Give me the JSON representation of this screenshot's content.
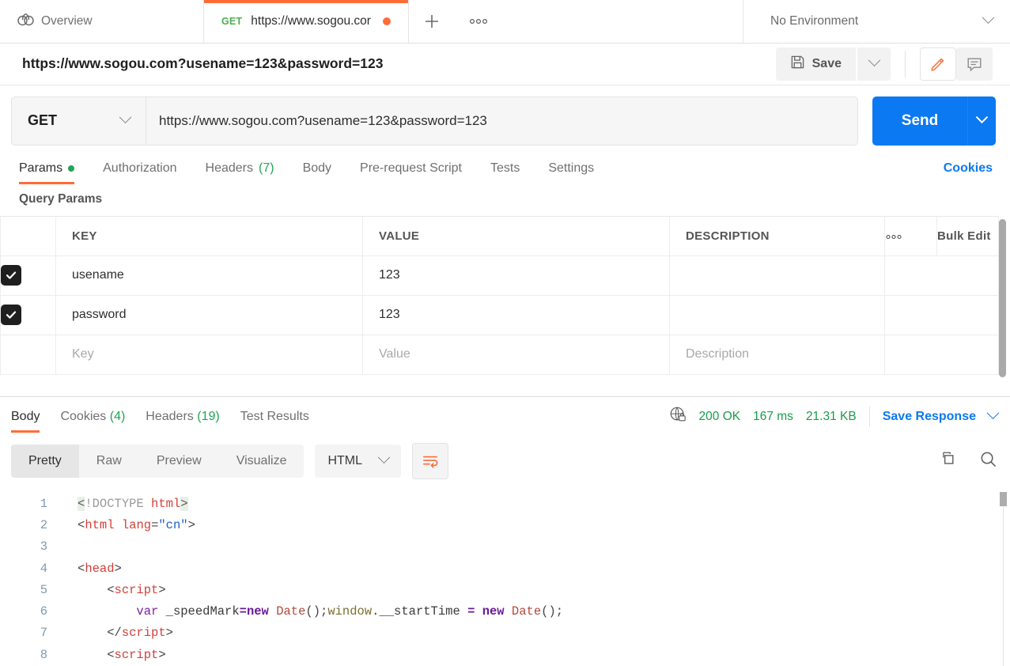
{
  "tabbar": {
    "overview_label": "Overview",
    "request_tab": {
      "method": "GET",
      "title": "https://www.sogou.cor"
    },
    "add_tab_label": "+",
    "more_label": "○○○",
    "environment": "No Environment"
  },
  "request_header": {
    "title": "https://www.sogou.com?usename=123&password=123",
    "save_label": "Save"
  },
  "url_row": {
    "method": "GET",
    "url": "https://www.sogou.com?usename=123&password=123",
    "send_label": "Send"
  },
  "request_tabs": [
    {
      "label": "Params",
      "dot": true
    },
    {
      "label": "Authorization"
    },
    {
      "label": "Headers",
      "count": "(7)"
    },
    {
      "label": "Body"
    },
    {
      "label": "Pre-request Script"
    },
    {
      "label": "Tests"
    },
    {
      "label": "Settings"
    }
  ],
  "cookies_link": "Cookies",
  "params": {
    "section_label": "Query Params",
    "columns": [
      "KEY",
      "VALUE",
      "DESCRIPTION"
    ],
    "more_label": "○○○",
    "bulk_edit_label": "Bulk Edit",
    "rows": [
      {
        "checked": true,
        "key": "usename",
        "value": "123",
        "description": ""
      },
      {
        "checked": true,
        "key": "password",
        "value": "123",
        "description": ""
      }
    ],
    "placeholder_row": {
      "key": "Key",
      "value": "Value",
      "description": "Description"
    }
  },
  "response": {
    "tabs": [
      {
        "label": "Body"
      },
      {
        "label": "Cookies",
        "count": "(4)"
      },
      {
        "label": "Headers",
        "count": "(19)"
      },
      {
        "label": "Test Results"
      }
    ],
    "status": "200 OK",
    "time": "167 ms",
    "size": "21.31 KB",
    "save_response_label": "Save Response",
    "view_modes": [
      "Pretty",
      "Raw",
      "Preview",
      "Visualize"
    ],
    "active_view": "Pretty",
    "format": "HTML"
  },
  "code": {
    "lines": [
      "1",
      "2",
      "3",
      "4",
      "5",
      "6",
      "7",
      "8"
    ]
  },
  "colors": {
    "accent": "#ff6c37",
    "primary": "#0b79f2",
    "success": "#1a9c4b",
    "method": "#4caf50"
  }
}
